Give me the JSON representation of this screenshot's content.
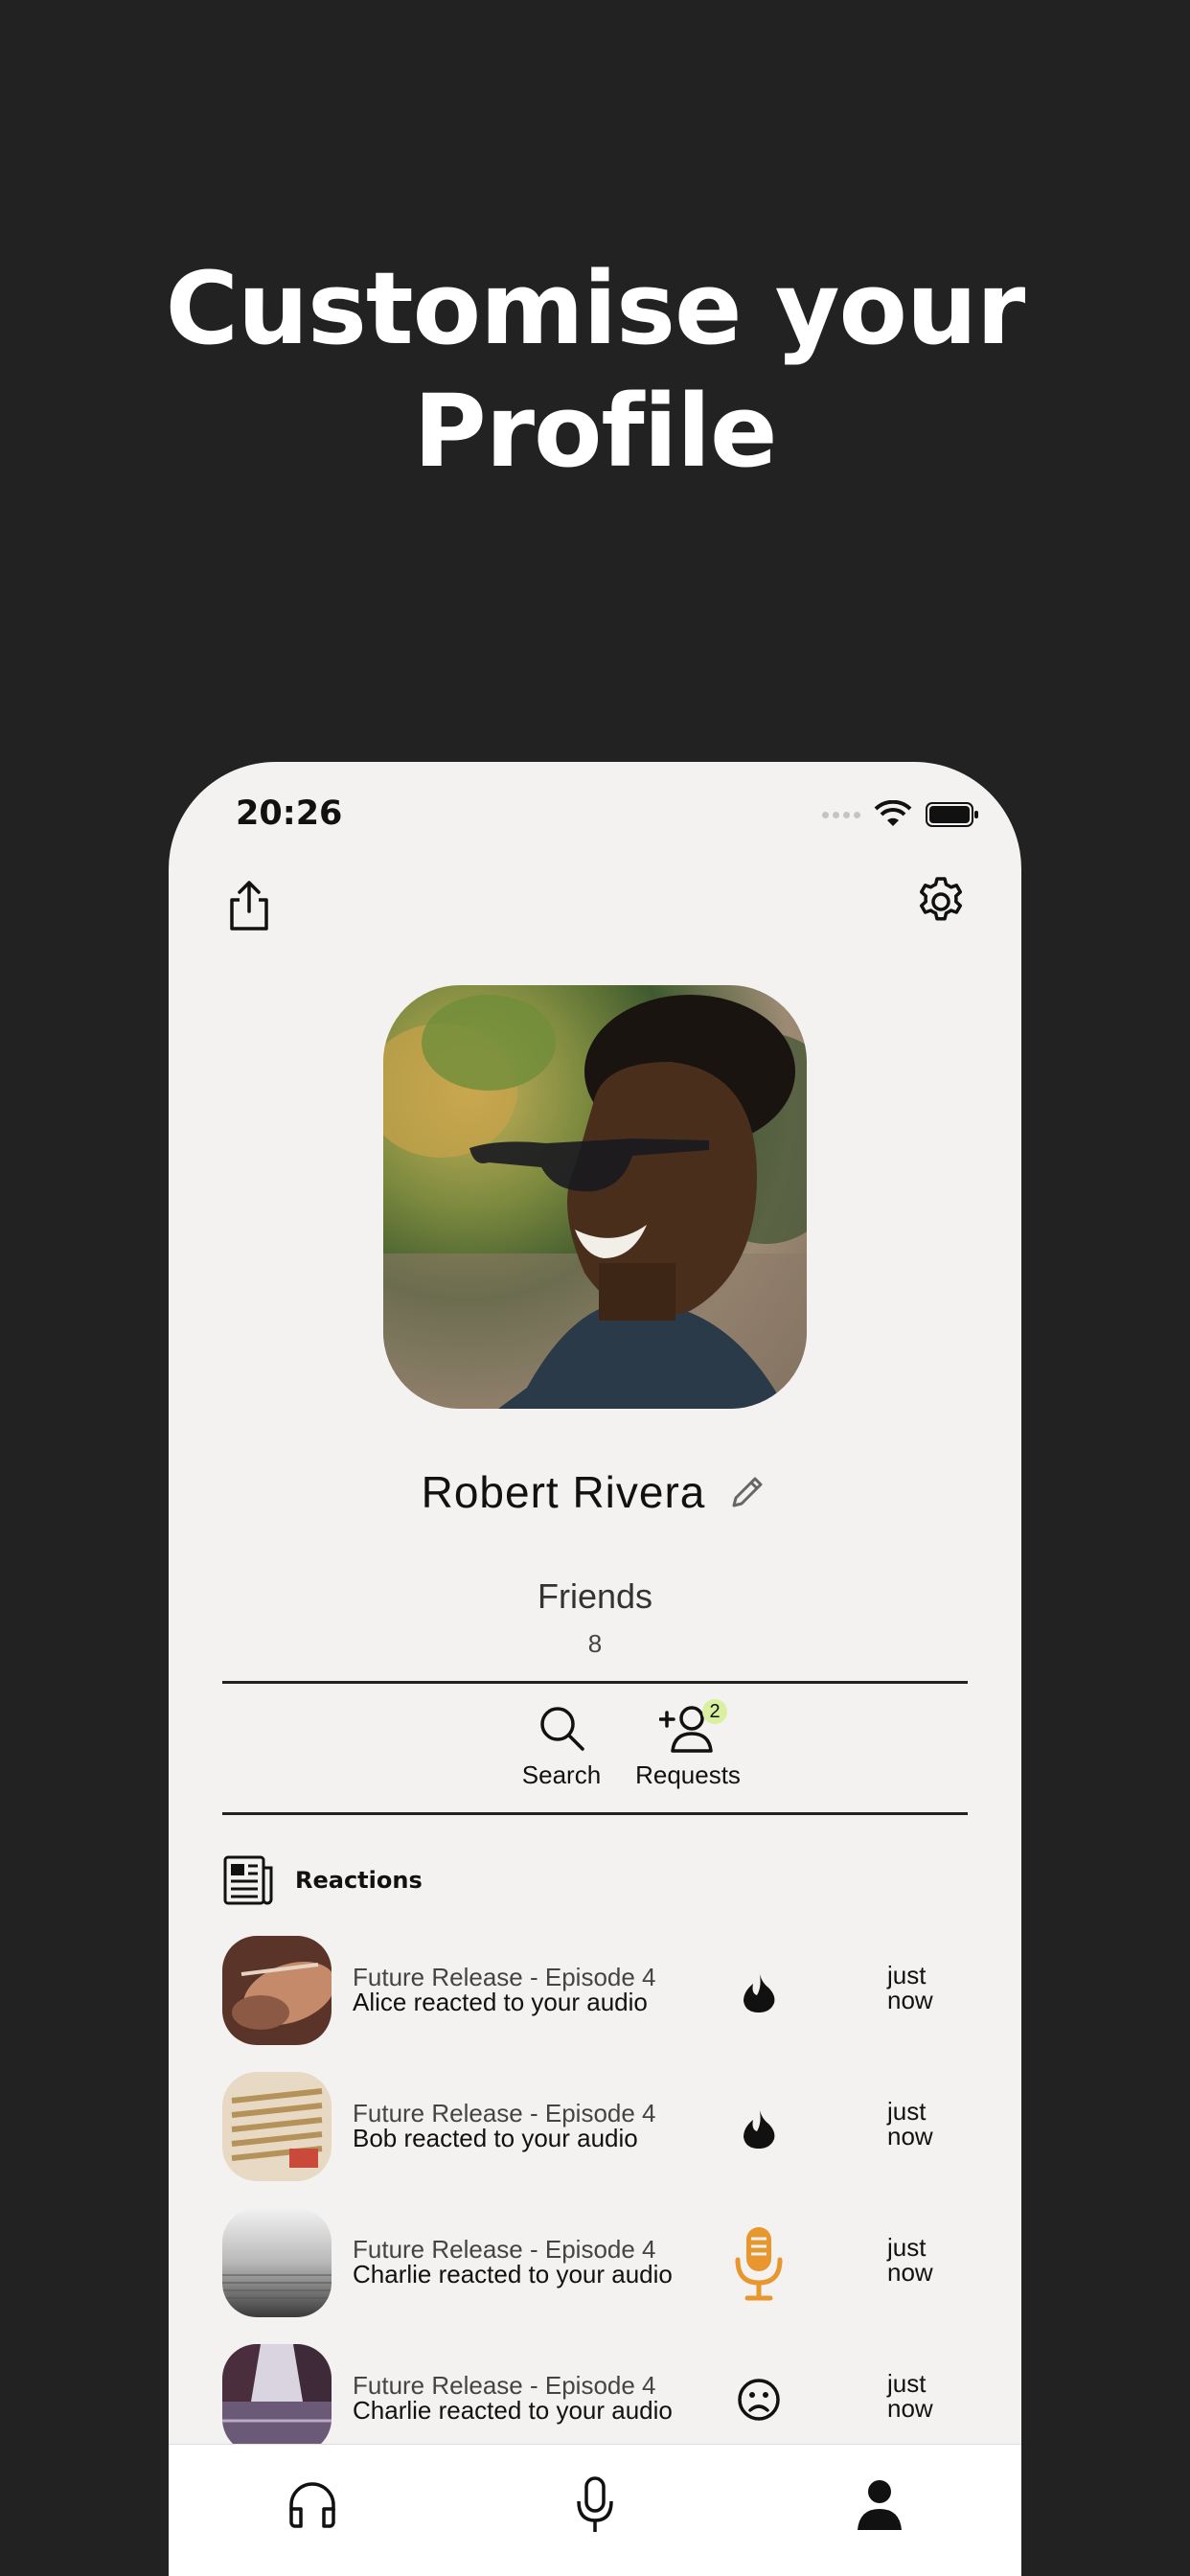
{
  "headline": {
    "line1": "Customise your",
    "line2": "Profile"
  },
  "status_bar": {
    "time": "20:26"
  },
  "profile": {
    "name": "Robert Rivera",
    "friends_label": "Friends",
    "friends_count": "8"
  },
  "actions": {
    "search_label": "Search",
    "requests_label": "Requests",
    "requests_badge": "2"
  },
  "reactions": {
    "title": "Reactions",
    "items": [
      {
        "title": "Future Release - Episode 4",
        "subtitle": "Alice reacted to your audio",
        "icon": "fire-icon",
        "time_1": "just",
        "time_2": "now"
      },
      {
        "title": "Future Release - Episode 4",
        "subtitle": "Bob reacted to your audio",
        "icon": "fire-icon",
        "time_1": "just",
        "time_2": "now"
      },
      {
        "title": "Future Release - Episode 4",
        "subtitle": "Charlie reacted to your audio",
        "icon": "microphone-icon",
        "time_1": "just",
        "time_2": "now"
      },
      {
        "title": "Future Release - Episode 4",
        "subtitle": "Charlie reacted to your audio",
        "icon": "sad-face-icon",
        "time_1": "just",
        "time_2": "now"
      }
    ]
  },
  "tabbar": {
    "tabs": [
      "headphones-icon",
      "microphone-icon",
      "person-icon"
    ],
    "active": "person-icon"
  },
  "colors": {
    "background": "#222222",
    "screen": "#f3f2f0",
    "accent_mic": "#e8962e",
    "badge": "#d8f0a0"
  }
}
